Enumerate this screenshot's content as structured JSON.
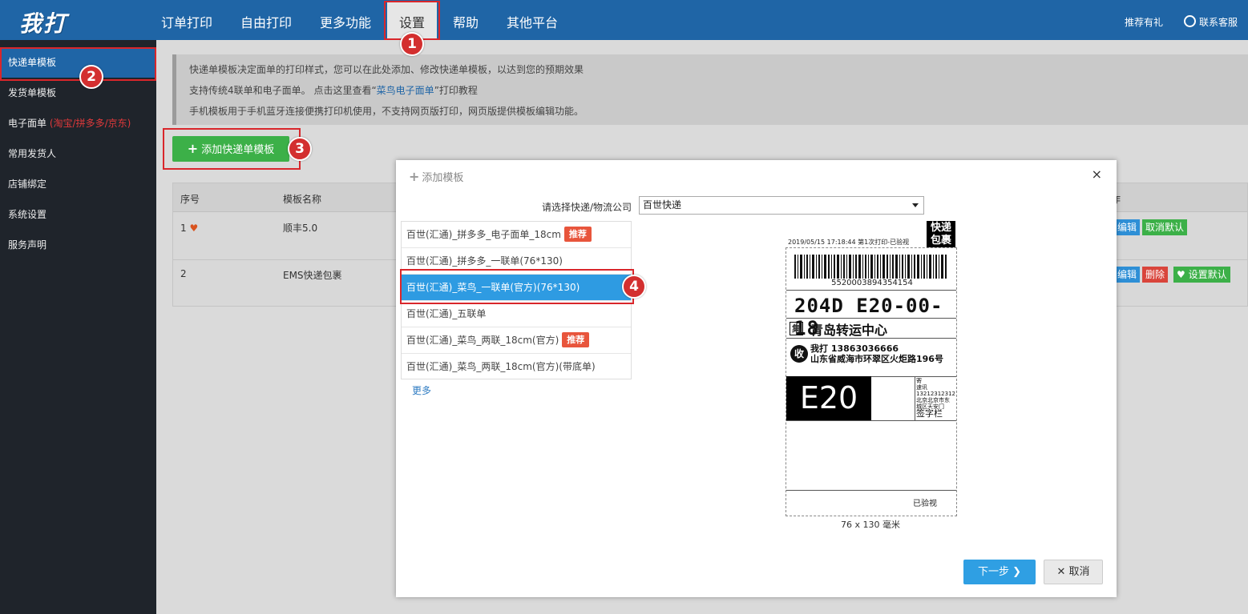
{
  "header": {
    "logo": "我打",
    "nav": [
      "订单打印",
      "自由打印",
      "更多功能",
      "设置",
      "帮助",
      "其他平台"
    ],
    "recommend": "推荐有礼",
    "contact": "联系客服"
  },
  "sidebar": {
    "items": [
      {
        "label": "快递单模板"
      },
      {
        "label": "发货单模板"
      },
      {
        "label": "电子面单",
        "note": "(淘宝/拼多多/京东)"
      },
      {
        "label": "常用发货人"
      },
      {
        "label": "店铺绑定"
      },
      {
        "label": "系统设置"
      },
      {
        "label": "服务声明"
      }
    ]
  },
  "info": {
    "line1": "快递单模板决定面单的打印样式，您可以在此处添加、修改快递单模板，以达到您的预期效果",
    "line2_pre": "支持传统4联单和电子面单。 点击这里查看“",
    "line2_link": "菜鸟电子面单",
    "line2_post": "”打印教程",
    "line3": "手机模板用于手机蓝牙连接便携打印机使用，不支持网页版打印，网页版提供模板编辑功能。"
  },
  "add_button": "添加快递单模板",
  "table": {
    "headers": {
      "index": "序号",
      "name": "模板名称",
      "actions": "作"
    },
    "rows": [
      {
        "index": "1",
        "name": "顺丰5.0",
        "actions": [
          "编辑",
          "取消默认"
        ]
      },
      {
        "index": "2",
        "name": "EMS快递包裹",
        "actions": [
          "编辑",
          "删除",
          "设置默认"
        ]
      }
    ]
  },
  "dialog": {
    "title": "添加模板",
    "close": "×",
    "select_label": "请选择快递/物流公司",
    "select_value": "百世快递",
    "templates": [
      {
        "label": "百世(汇通)_拼多多_电子面单_18cm",
        "tag": "推荐"
      },
      {
        "label": "百世(汇通)_拼多多_一联单(76*130)",
        "tag": ""
      },
      {
        "label": "百世(汇通)_菜鸟_一联单(官方)(76*130)",
        "tag": ""
      },
      {
        "label": "百世(汇通)_五联单",
        "tag": ""
      },
      {
        "label": "百世(汇通)_菜鸟_两联_18cm(官方)",
        "tag": "推荐"
      },
      {
        "label": "百世(汇通)_菜鸟_两联_18cm(官方)(带底单)",
        "tag": ""
      }
    ],
    "more": "更多",
    "preview": {
      "kuaidi_badge_1": "快递",
      "kuaidi_badge_2": "包裹",
      "date_line": "2019/05/15 17:18:44 第1次打印-已验视",
      "barcode_number": "5520003894354154",
      "sort_code": "204D   E20-00-18",
      "ji": "集",
      "center": "青岛转运中心",
      "shou": "收",
      "receiver_line1": "我打  13863036666",
      "receiver_line2": "山东省威海市环翠区火炬路196号",
      "e20": "E20",
      "sender_small_1": "寄",
      "sender_small_2": "速讯",
      "sender_small_3": "13212312312",
      "sender_small_4": "北京北京市东",
      "sender_small_5": "城区天安门",
      "sign": "签字栏",
      "inspected": "已验视",
      "size": "76 x 130 毫米"
    },
    "next_button": "下一步",
    "cancel_button": "取消"
  },
  "callouts": [
    "1",
    "2",
    "3",
    "4"
  ],
  "colors": {
    "header_bg": "#1f65a6",
    "sidebar_bg": "#1f242b",
    "add_green": "#3cb048",
    "selected_blue": "#2e9be2",
    "tag_red": "#e8553c",
    "callout_red": "#d32f2f"
  }
}
